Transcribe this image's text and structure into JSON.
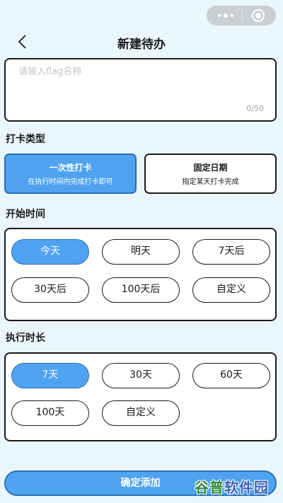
{
  "header": {
    "title": "新建待办"
  },
  "name_input": {
    "placeholder": "请输入flag名称",
    "value": "",
    "counter": "0/50"
  },
  "checkin_type": {
    "label": "打卡类型",
    "options": [
      {
        "title": "一次性打卡",
        "desc": "在执行时间内完成打卡即可",
        "selected": true
      },
      {
        "title": "固定日期",
        "desc": "指定某天打卡完成",
        "selected": false
      }
    ]
  },
  "start_time": {
    "label": "开始时间",
    "options": [
      "今天",
      "明天",
      "7天后",
      "30天后",
      "100天后",
      "自定义"
    ],
    "selected": "今天"
  },
  "duration": {
    "label": "执行时长",
    "options": [
      "7天",
      "30天",
      "60天",
      "100天",
      "自定义"
    ],
    "selected": "7天"
  },
  "confirm_label": "确定添加",
  "watermark": {
    "part1": "谷普",
    "part2": "软件园"
  },
  "colors": {
    "accent": "#4fa3f0",
    "background": "#e9f6fb",
    "border": "#1a1a1a"
  }
}
